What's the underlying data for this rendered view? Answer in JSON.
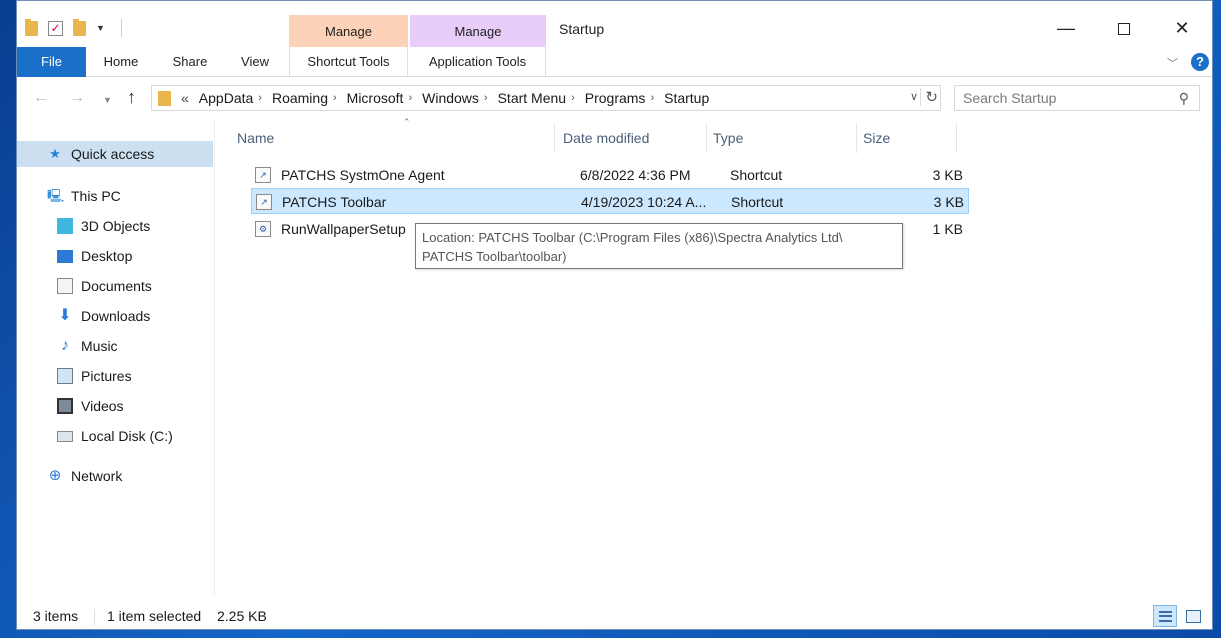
{
  "window": {
    "title": "Startup"
  },
  "ribbon": {
    "tabs": [
      "File",
      "Home",
      "Share",
      "View",
      "Shortcut Tools",
      "Application Tools"
    ],
    "context_groups": [
      "Manage",
      "Manage"
    ]
  },
  "address": {
    "overflow": "«",
    "crumbs": [
      "AppData",
      "Roaming",
      "Microsoft",
      "Windows",
      "Start Menu",
      "Programs",
      "Startup"
    ]
  },
  "search": {
    "placeholder": "Search Startup"
  },
  "nav": {
    "items": [
      {
        "label": "Quick access",
        "icon": "star-icon"
      },
      {
        "label": "This PC",
        "icon": "computer-icon"
      },
      {
        "label": "3D Objects",
        "icon": "cube-icon"
      },
      {
        "label": "Desktop",
        "icon": "desktop-icon"
      },
      {
        "label": "Documents",
        "icon": "documents-icon"
      },
      {
        "label": "Downloads",
        "icon": "download-icon"
      },
      {
        "label": "Music",
        "icon": "music-icon"
      },
      {
        "label": "Pictures",
        "icon": "pictures-icon"
      },
      {
        "label": "Videos",
        "icon": "videos-icon"
      },
      {
        "label": "Local Disk (C:)",
        "icon": "disk-icon"
      },
      {
        "label": "Network",
        "icon": "network-icon"
      }
    ]
  },
  "columns": {
    "name": "Name",
    "date": "Date modified",
    "type": "Type",
    "size": "Size"
  },
  "files": [
    {
      "name": "PATCHS SystmOne Agent",
      "date": "6/8/2022 4:36 PM",
      "type": "Shortcut",
      "size": "3 KB"
    },
    {
      "name": "PATCHS Toolbar",
      "date": "4/19/2023 10:24 A...",
      "type": "Shortcut",
      "size": "3 KB"
    },
    {
      "name": "RunWallpaperSetup",
      "date": "",
      "type": "",
      "size": "1 KB"
    }
  ],
  "tooltip": {
    "line1": "Location: PATCHS Toolbar (C:\\Program Files (x86)\\Spectra Analytics Ltd\\",
    "line2": "PATCHS Toolbar\\toolbar)"
  },
  "status": {
    "count": "3 items",
    "selected": "1 item selected",
    "size": "2.25 KB"
  }
}
